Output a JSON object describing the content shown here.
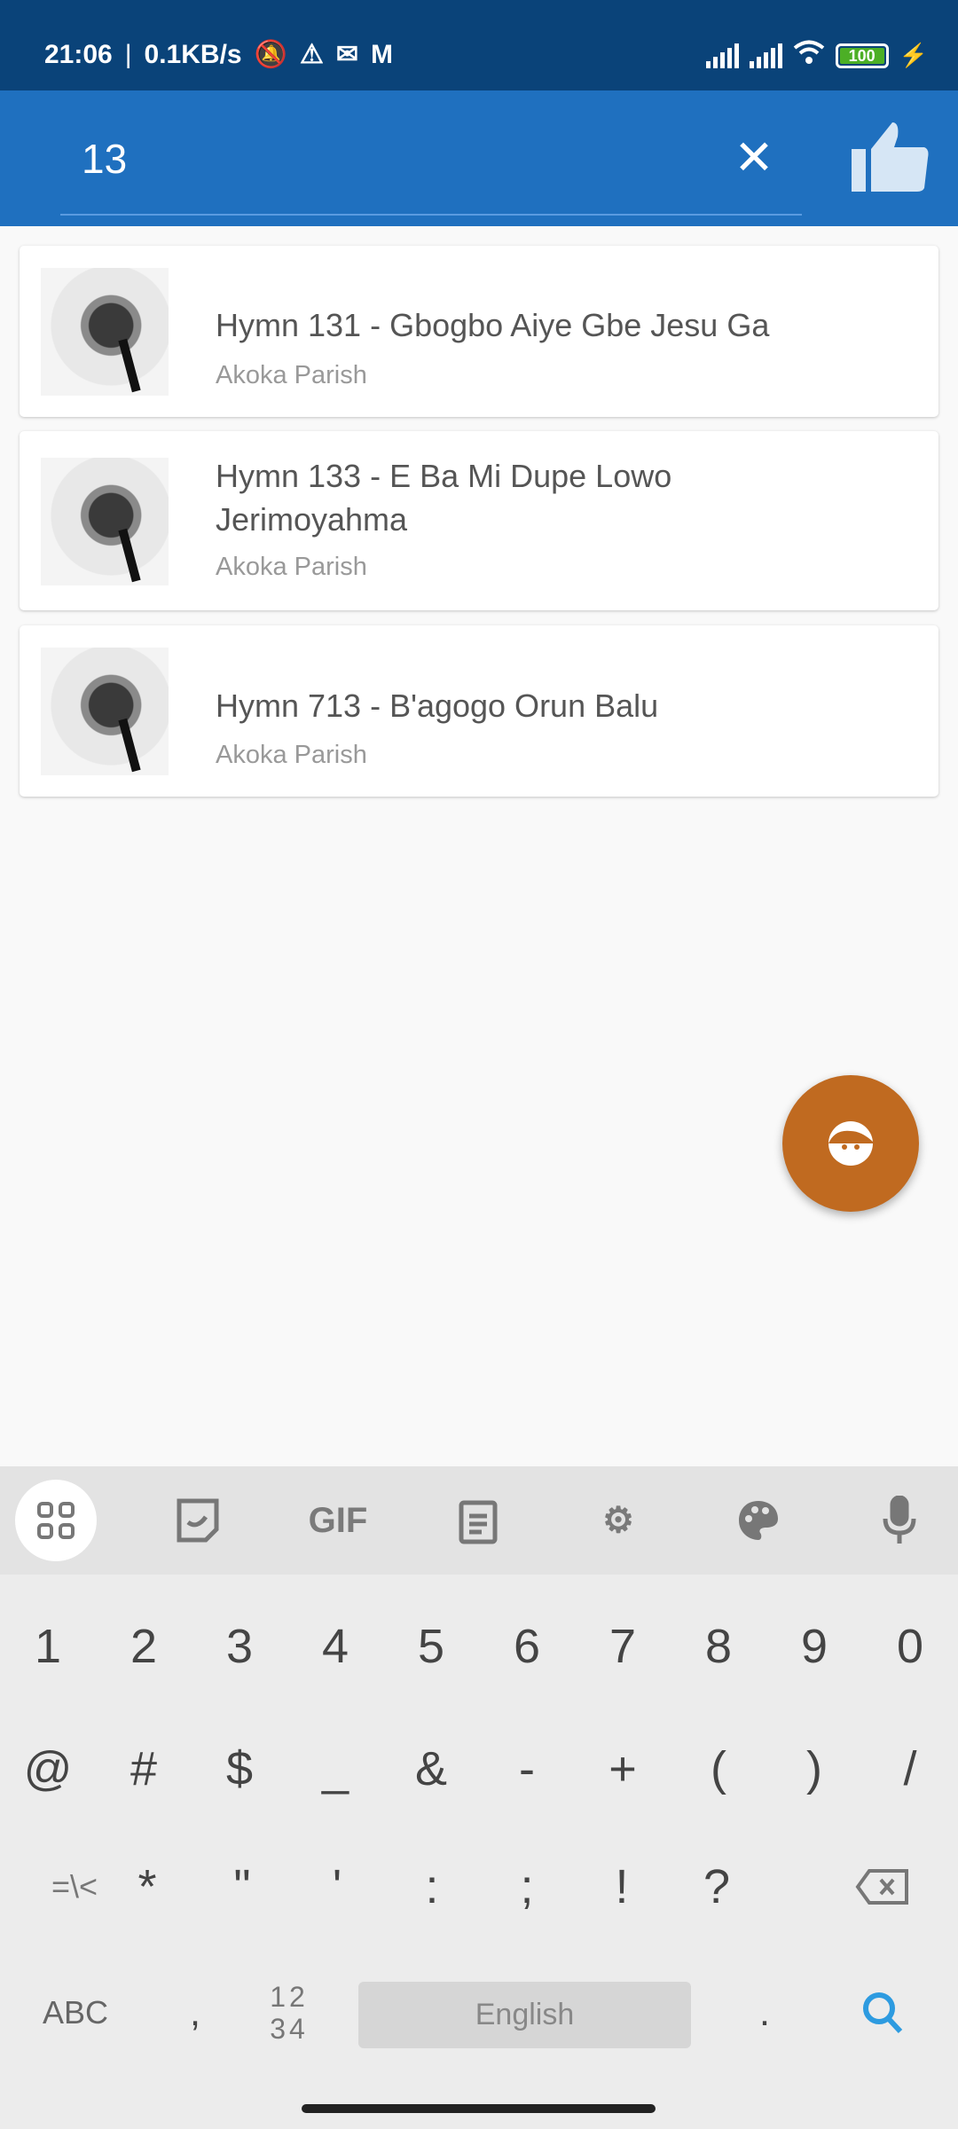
{
  "status_bar": {
    "time": "21:06",
    "speed": "0.1KB/s",
    "battery": "100",
    "icons": [
      "bell-off-icon",
      "warning-icon",
      "outlook-icon",
      "gmail-icon",
      "signal-icon",
      "signal-icon",
      "wifi-icon",
      "battery-icon",
      "charging-icon"
    ]
  },
  "search": {
    "value": "13",
    "clear_icon": "close-icon",
    "like_icon": "thumbs-up-icon"
  },
  "results": [
    {
      "title": "Hymn 131 - Gbogbo Aiye Gbe Jesu Ga",
      "subtitle": "Akoka Parish"
    },
    {
      "title": "Hymn 133 - E Ba Mi Dupe Lowo Jerimoyahma",
      "subtitle": "Akoka Parish"
    },
    {
      "title": "Hymn 713 - B'agogo Orun Balu",
      "subtitle": "Akoka Parish"
    }
  ],
  "fab": {
    "icon": "face-icon",
    "color": "#c06a20"
  },
  "keyboard": {
    "toolbar": {
      "gif": "GIF"
    },
    "row1": [
      "1",
      "2",
      "3",
      "4",
      "5",
      "6",
      "7",
      "8",
      "9",
      "0"
    ],
    "row2": [
      "@",
      "#",
      "$",
      "_",
      "&",
      "-",
      "+",
      "(",
      ")",
      "/"
    ],
    "row3": [
      "=\\<",
      "*",
      "\"",
      "'",
      ":",
      ";",
      "!",
      "?"
    ],
    "abc": "ABC",
    "comma": ",",
    "numpad_top": "12",
    "numpad_bottom": "34",
    "space": "English",
    "period": "."
  },
  "colors": {
    "status_bar": "#0a4379",
    "app_bar": "#1f70bf",
    "accent": "#2d9be0"
  }
}
